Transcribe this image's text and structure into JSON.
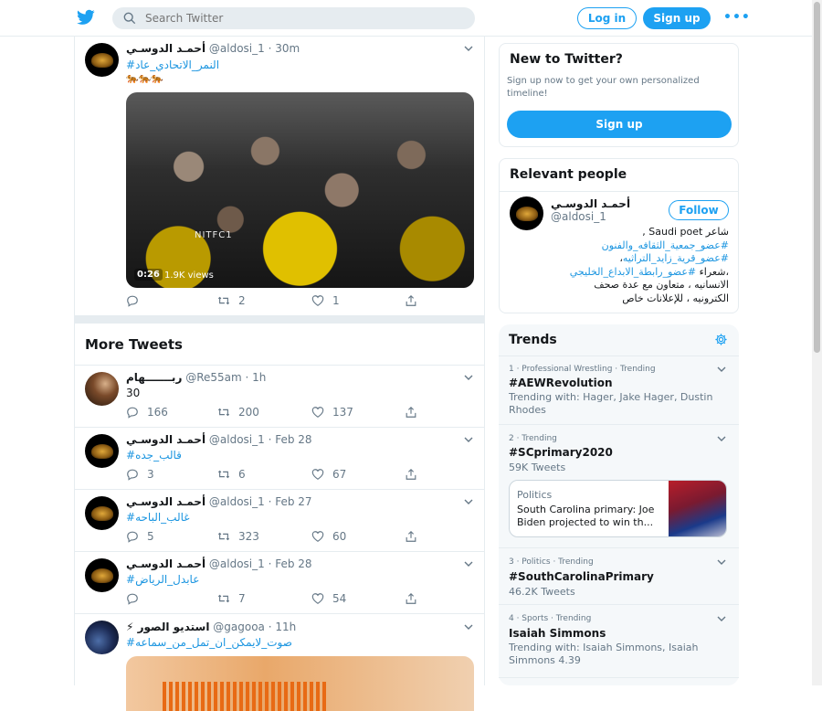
{
  "header": {
    "search_placeholder": "Search Twitter",
    "login_label": "Log in",
    "signup_label": "Sign up",
    "more_label": "•••"
  },
  "main": {
    "top_tweet": {
      "name": "أحمـد الدوسـي",
      "handle": "@aldosi_1",
      "time": "· 30m",
      "hashtag": "#النمر_الاتحادي_عاد",
      "emoji": "🐅🐅🐅",
      "video_watermark": "NITFC1",
      "video_duration": "0:26",
      "video_views": "1.9K views",
      "retweets": "2",
      "likes": "1"
    },
    "more_tweets_title": "More Tweets",
    "tweets": [
      {
        "name": "ربـــــــهام",
        "handle": "@Re55am",
        "time": "· 1h",
        "text": "30",
        "replies": "166",
        "retweets": "200",
        "likes": "137"
      },
      {
        "name": "أحمـد الدوسـي",
        "handle": "@aldosi_1",
        "time": "· Feb 28",
        "text": "#قالب_جده",
        "replies": "3",
        "retweets": "6",
        "likes": "67"
      },
      {
        "name": "أحمـد الدوسـي",
        "handle": "@aldosi_1",
        "time": "· Feb 27",
        "text": "#غالب_الباحه",
        "replies": "5",
        "retweets": "323",
        "likes": "60"
      },
      {
        "name": "أحمـد الدوسـي",
        "handle": "@aldosi_1",
        "time": "· Feb 28",
        "text": "#عابدل_الرياض",
        "replies": "",
        "retweets": "7",
        "likes": "54"
      }
    ],
    "last_tweet": {
      "name": "⚡ استديو الصور",
      "handle": "@gagooa",
      "time": "· 11h",
      "text": "#صوت_لايمكن_ان_تمل_من_سماعه"
    }
  },
  "sidebar": {
    "new_to_twitter": {
      "title": "New to Twitter?",
      "desc": "Sign up now to get your own personalized timeline!",
      "button": "Sign up"
    },
    "relevant": {
      "title": "Relevant people",
      "name": "أحمـد الدوسـي",
      "handle": "@aldosi_1",
      "follow": "Follow",
      "bio_line1": "شاعر Saudi poet ,",
      "bio_tag1": "#عضو_جمعية_الثقافه_والفنون",
      "bio_tag2": "#عضو_قرية_زايد_التراثيه",
      "bio_tag3": "#عضو_رابطة_الابداع_الخليجي",
      "bio_line2": "،شعراء",
      "bio_line3": "الانسانيه ، متعاون مع عدة صحف",
      "bio_line4": "الكترونيه ، للإعلانات خاص"
    },
    "trends": {
      "title": "Trends",
      "items": [
        {
          "meta": "1 · Professional Wrestling · Trending",
          "name": "#AEWRevolution",
          "sub": "Trending with: Hager, Jake Hager, Dustin Rhodes"
        },
        {
          "meta": "2 · Trending",
          "name": "#SCprimary2020",
          "sub": "59K Tweets",
          "news_cat": "Politics",
          "news_title": "South Carolina primary: Joe Biden projected to win th..."
        },
        {
          "meta": "3 · Politics · Trending",
          "name": "#SouthCarolinaPrimary",
          "sub": "46.2K Tweets"
        },
        {
          "meta": "4 · Sports · Trending",
          "name": "Isaiah Simmons",
          "sub": "Trending with: Isaiah Simmons, Isaiah Simmons 4.39"
        }
      ]
    }
  },
  "colors": {
    "accent": "#1da1f2",
    "text": "#14171a",
    "muted": "#657786",
    "border": "#e6ecf0"
  }
}
